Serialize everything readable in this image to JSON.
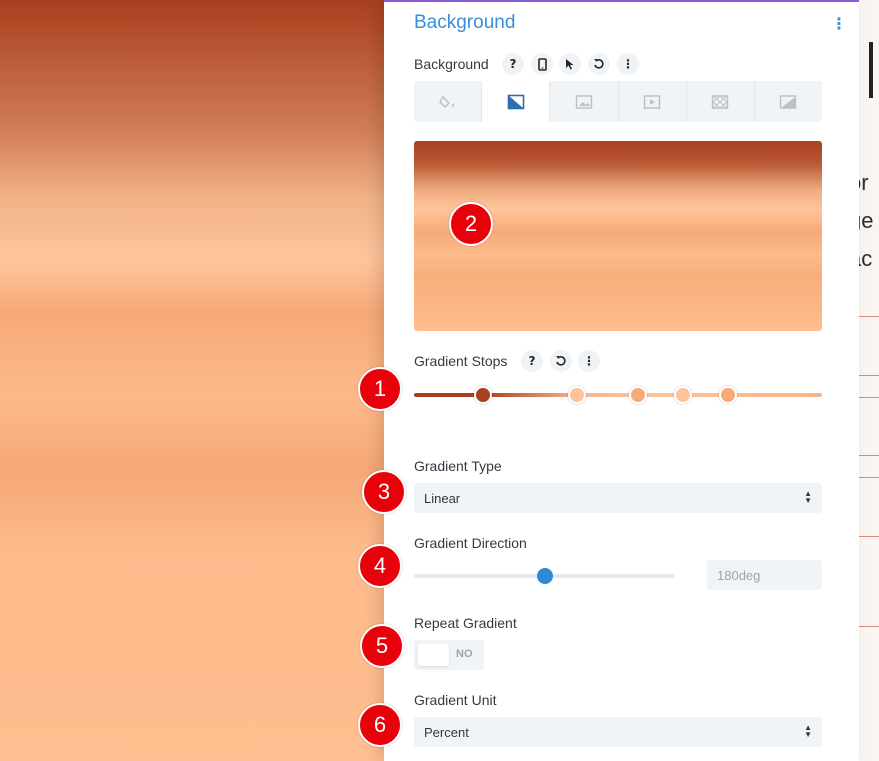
{
  "panel": {
    "title": "Background",
    "menu_icon": "kebab-vertical-icon"
  },
  "background": {
    "label": "Background",
    "icons": [
      "help-icon",
      "mobile-icon",
      "cursor-icon",
      "reset-icon",
      "more-icon"
    ]
  },
  "tabs": [
    {
      "name": "color",
      "icon": "paint-bucket-icon",
      "active": false
    },
    {
      "name": "gradient",
      "icon": "gradient-icon",
      "active": true
    },
    {
      "name": "image",
      "icon": "image-icon",
      "active": false
    },
    {
      "name": "video",
      "icon": "video-icon",
      "active": false
    },
    {
      "name": "pattern",
      "icon": "pattern-icon",
      "active": false
    },
    {
      "name": "mask",
      "icon": "mask-icon",
      "active": false
    }
  ],
  "gradient_stops": {
    "label": "Gradient Stops",
    "stops": [
      {
        "position_pct": 17,
        "color": "#a93f1e"
      },
      {
        "position_pct": 40,
        "color": "#fdc49c"
      },
      {
        "position_pct": 55,
        "color": "#f7a978"
      },
      {
        "position_pct": 66,
        "color": "#fdc49c"
      },
      {
        "position_pct": 77,
        "color": "#f7a978"
      }
    ]
  },
  "gradient_type": {
    "label": "Gradient Type",
    "value": "Linear"
  },
  "gradient_direction": {
    "label": "Gradient Direction",
    "value": "180deg",
    "slider_fraction": 0.5
  },
  "repeat_gradient": {
    "label": "Repeat Gradient",
    "value": "NO"
  },
  "gradient_unit": {
    "label": "Gradient Unit",
    "value": "Percent"
  },
  "markers": [
    "1",
    "2",
    "3",
    "4",
    "5",
    "6"
  ],
  "page_fragments": [
    "or",
    "ge",
    "ac"
  ],
  "colors": {
    "accent": "#3a8ed6",
    "marker": "#e8000b",
    "panel_top_border": "#8a5cd6"
  }
}
